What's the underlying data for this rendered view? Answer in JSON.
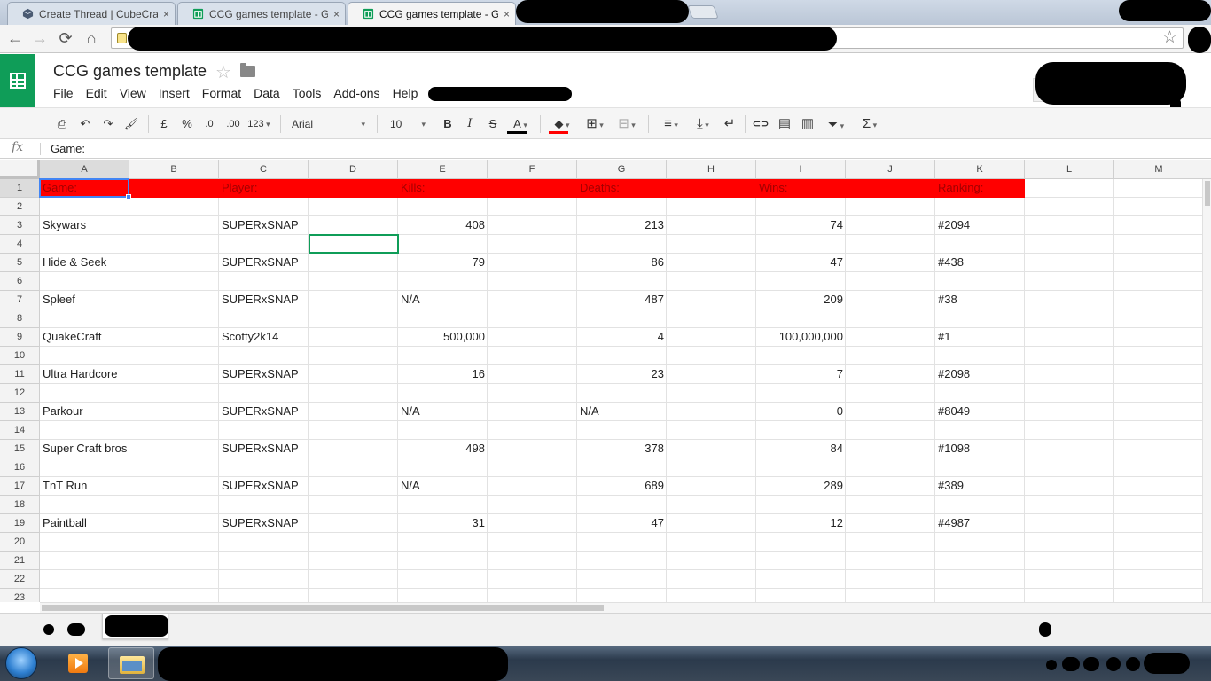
{
  "browser": {
    "tabs": [
      {
        "title": "Create Thread | CubeCraft",
        "close": "×",
        "icon": "cube-icon"
      },
      {
        "title": "CCG games template - Go",
        "close": "×",
        "icon": "sheets-icon"
      },
      {
        "title": "CCG games template - Go",
        "close": "×",
        "icon": "sheets-icon"
      }
    ],
    "nav": {
      "back": "←",
      "forward": "→",
      "reload": "⟳",
      "home": "⌂",
      "bookmark": "☆"
    }
  },
  "doc": {
    "title": "CCG games template",
    "menu": [
      "File",
      "Edit",
      "View",
      "Insert",
      "Format",
      "Data",
      "Tools",
      "Add-ons",
      "Help"
    ]
  },
  "toolbar": {
    "print": "⎙",
    "undo": "↶",
    "redo": "↷",
    "paint_format": "🖌",
    "currency": "£",
    "percent": "%",
    "dec_decrease": ".0",
    "dec_increase": ".00",
    "more_formats": "123",
    "font": "Arial",
    "font_size": "10",
    "bold": "B",
    "italic": "I",
    "strike": "S",
    "text_color": "A",
    "fill_color": "◆",
    "borders": "⊞",
    "merge": "⊟",
    "align": "≡",
    "valign": "⤓",
    "wrap": "↵",
    "link": "⊂⊃",
    "comment": "▤",
    "chart": "▥",
    "filter": "⏷",
    "functions": "Σ",
    "text_color_hex": "#000000",
    "fill_color_hex": "#ff0000"
  },
  "formula": {
    "fx": "fx",
    "value": "Game:"
  },
  "grid": {
    "columns": [
      "A",
      "B",
      "C",
      "D",
      "E",
      "F",
      "G",
      "H",
      "I",
      "J",
      "K",
      "L",
      "M"
    ],
    "rows": [
      "1",
      "2",
      "3",
      "4",
      "5",
      "6",
      "7",
      "8",
      "9",
      "10",
      "11",
      "12",
      "13",
      "14",
      "15",
      "16",
      "17",
      "18",
      "19",
      "20",
      "21",
      "22",
      "23"
    ],
    "header": {
      "game": "Game:",
      "player": "Player:",
      "kills": "Kills:",
      "deaths": "Deaths:",
      "wins": "Wins:",
      "ranking": "Ranking:"
    },
    "header_color": "#ff0000",
    "records": [
      {
        "row": 3,
        "game": "Skywars",
        "player": "SUPERxSNAP",
        "kills": "408",
        "deaths": "213",
        "wins": "74",
        "ranking": "#2094"
      },
      {
        "row": 5,
        "game": "Hide & Seek",
        "player": "SUPERxSNAP",
        "kills": "79",
        "deaths": "86",
        "wins": "47",
        "ranking": "#438"
      },
      {
        "row": 7,
        "game": "Spleef",
        "player": "SUPERxSNAP",
        "kills": "N/A",
        "deaths": "487",
        "wins": "209",
        "ranking": "#38"
      },
      {
        "row": 9,
        "game": "QuakeCraft",
        "player": "Scotty2k14",
        "kills": "500,000",
        "deaths": "4",
        "wins": "100,000,000",
        "ranking": "#1"
      },
      {
        "row": 11,
        "game": "Ultra Hardcore",
        "player": "SUPERxSNAP",
        "kills": "16",
        "deaths": "23",
        "wins": "7",
        "ranking": "#2098"
      },
      {
        "row": 13,
        "game": "Parkour",
        "player": "SUPERxSNAP",
        "kills": "N/A",
        "deaths": "N/A",
        "wins": "0",
        "ranking": "#8049"
      },
      {
        "row": 15,
        "game": "Super Craft bros",
        "player": "SUPERxSNAP",
        "kills": "498",
        "deaths": "378",
        "wins": "84",
        "ranking": "#1098"
      },
      {
        "row": 17,
        "game": "TnT Run",
        "player": "SUPERxSNAP",
        "kills": "N/A",
        "deaths": "689",
        "wins": "289",
        "ranking": "#389"
      },
      {
        "row": 19,
        "game": "Paintball",
        "player": "SUPERxSNAP",
        "kills": "31",
        "deaths": "47",
        "wins": "12",
        "ranking": "#4987"
      }
    ]
  }
}
